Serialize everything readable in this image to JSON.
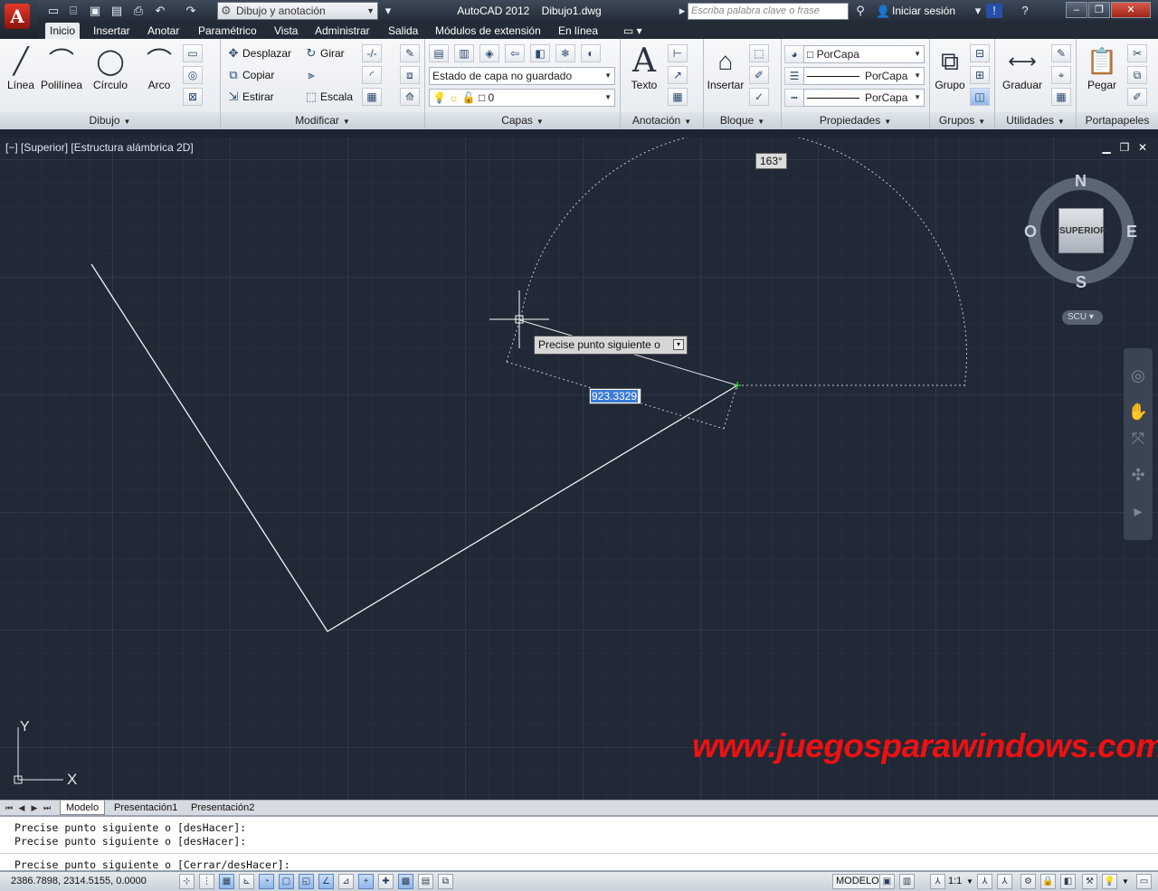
{
  "titlebar": {
    "workspace": "Dibujo y anotación",
    "app_name": "AutoCAD 2012",
    "document": "Dibujo1.dwg",
    "search_placeholder": "Escriba palabra clave o frase",
    "signin": "Iniciar sesión"
  },
  "tabs": [
    "Inicio",
    "Insertar",
    "Anotar",
    "Paramétrico",
    "Vista",
    "Administrar",
    "Salida",
    "Módulos de extensión",
    "En línea"
  ],
  "ribbon": {
    "dibujo": {
      "title": "Dibujo",
      "linea": "Línea",
      "polilinea": "Polilínea",
      "circulo": "Círculo",
      "arco": "Arco"
    },
    "modificar": {
      "title": "Modificar",
      "desplazar": "Desplazar",
      "girar": "Girar",
      "copiar": "Copiar",
      "estirar": "Estirar",
      "escala": "Escala"
    },
    "capas": {
      "title": "Capas",
      "estado": "Estado de capa no guardado",
      "layer": "0"
    },
    "anotacion": {
      "title": "Anotación",
      "texto": "Texto"
    },
    "bloque": {
      "title": "Bloque",
      "insertar": "Insertar"
    },
    "propiedades": {
      "title": "Propiedades",
      "color": "PorCapa",
      "linetype": "PorCapa",
      "lineweight": "PorCapa"
    },
    "grupos": {
      "title": "Grupos",
      "grupo": "Grupo"
    },
    "utilidades": {
      "title": "Utilidades",
      "graduar": "Graduar"
    },
    "portapapeles": {
      "title": "Portapapeles",
      "pegar": "Pegar"
    }
  },
  "viewport": {
    "label": "[−] [Superior] [Estructura alámbrica 2D]",
    "angle": "163°",
    "prompt": "Precise punto siguiente o",
    "dyn_value": "923.3329",
    "watermark": "www.juegosparawindows.com"
  },
  "viewcube": {
    "face": "SUPERIOR",
    "n": "N",
    "s": "S",
    "e": "E",
    "w": "O",
    "ucs": "SCU"
  },
  "ucs_icon": {
    "x": "X",
    "y": "Y"
  },
  "layout_tabs": [
    "Modelo",
    "Presentación1",
    "Presentación2"
  ],
  "command": {
    "line1": "Precise punto siguiente o [desHacer]:",
    "line2": "Precise punto siguiente o [desHacer]:",
    "current": "Precise punto siguiente o [Cerrar/desHacer]:"
  },
  "status": {
    "coords": "2386.7898, 2314.5155, 0.0000",
    "modelo": "MODELO",
    "scale": "1:1"
  }
}
